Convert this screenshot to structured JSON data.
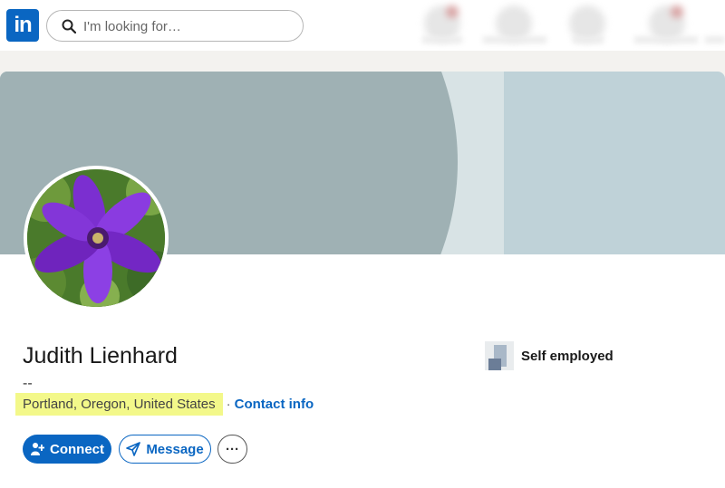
{
  "header": {
    "logo_text": "in",
    "search_placeholder": "I'm looking for…"
  },
  "profile": {
    "name": "Judith Lienhard",
    "headline": "--",
    "location": "Portland, Oregon, United States",
    "separator": "·",
    "contact_info": "Contact info",
    "company": "Self employed"
  },
  "actions": {
    "connect": "Connect",
    "message": "Message",
    "more": "···"
  },
  "colors": {
    "brand": "#0a66c2",
    "highlight": "#f3f88a"
  }
}
